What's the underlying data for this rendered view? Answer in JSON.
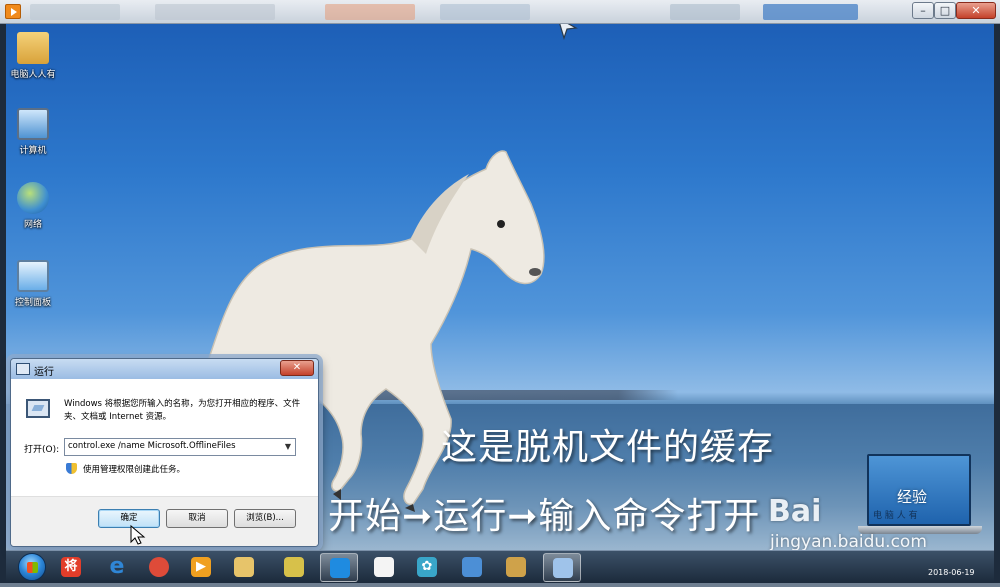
{
  "outer_window": {
    "controls": {
      "minimize": "–",
      "maximize": "□",
      "close": "✕"
    }
  },
  "desktop_icons": [
    {
      "label": "电脑人人有",
      "icon": "folder-user-icon",
      "color": "#e8b64a"
    },
    {
      "label": "计算机",
      "icon": "computer-icon",
      "color": "#5aa0d8"
    },
    {
      "label": "网络",
      "icon": "network-icon",
      "color": "#3f8fd0"
    },
    {
      "label": "控制面板",
      "icon": "control-panel-icon",
      "color": "#6aaee8"
    }
  ],
  "overlay_captions": {
    "line1": "这是脱机文件的缓存",
    "line2_a": "开始",
    "line2_b": "运行",
    "line2_c": "输入命令打开",
    "arrow": "➞"
  },
  "watermark": {
    "brand": "Bai",
    "brand2": "经验",
    "site": "jingyan.baidu.com",
    "screen_text": "电 脑 人 有",
    "date": "2018-06-19"
  },
  "run_dialog": {
    "title": "运行",
    "description": "Windows 将根据您所输入的名称，为您打开相应的程序、文件夹、文档或 Internet 资源。",
    "open_label": "打开(O):",
    "command": "control.exe /name Microsoft.OfflineFiles",
    "admin_note": "使用管理权限创建此任务。",
    "ok_label": "确定",
    "cancel_label": "取消",
    "browse_label": "浏览(B)...",
    "close_glyph": "✕"
  },
  "taskbar": {
    "items": [
      {
        "icon": "jiang-app-icon",
        "glyph": "将",
        "color": "#e23d2a"
      },
      {
        "icon": "internet-explorer-icon",
        "glyph": "e",
        "color": "#2f86d6"
      },
      {
        "icon": "chrome-icon",
        "glyph": "",
        "color": "#de4b39"
      },
      {
        "icon": "media-player-icon",
        "glyph": "▶",
        "color": "#f0a020"
      },
      {
        "icon": "file-explorer-icon",
        "glyph": "",
        "color": "#e7c46a"
      },
      {
        "icon": "notes-icon",
        "glyph": "",
        "color": "#d7c14a"
      },
      {
        "icon": "browser-icon",
        "glyph": "",
        "color": "#1f8be0"
      },
      {
        "icon": "document-icon",
        "glyph": "",
        "color": "#f4f4f4"
      },
      {
        "icon": "pinwheel-icon",
        "glyph": "✿",
        "color": "#39a6c9"
      },
      {
        "icon": "remote-desktop-icon",
        "glyph": "",
        "color": "#4c8fd6"
      },
      {
        "icon": "paint-icon",
        "glyph": "",
        "color": "#cfa24a"
      },
      {
        "icon": "run-icon",
        "glyph": "",
        "color": "#9fc3ea"
      }
    ]
  }
}
